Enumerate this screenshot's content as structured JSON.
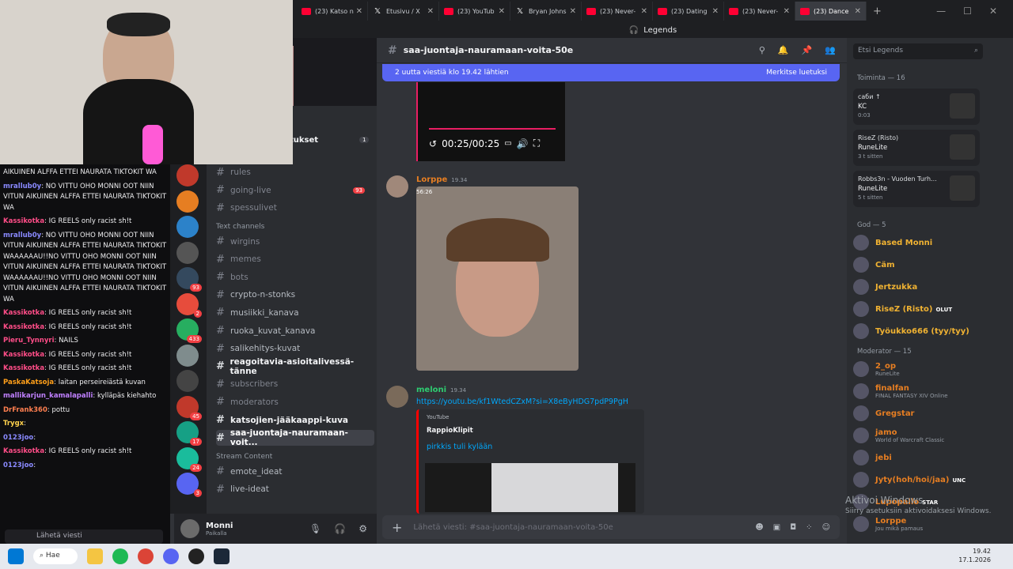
{
  "browser": {
    "tabs": [
      {
        "label": "(23) Katso n",
        "icon": "youtube"
      },
      {
        "label": "Etusivu / X",
        "icon": "x"
      },
      {
        "label": "(23) YouTub",
        "icon": "youtube"
      },
      {
        "label": "Bryan Johns",
        "icon": "x"
      },
      {
        "label": "(23) Never-",
        "icon": "youtube"
      },
      {
        "label": "(23) Dating",
        "icon": "youtube"
      },
      {
        "label": "(23) Never-",
        "icon": "youtube"
      },
      {
        "label": "(23) Dance",
        "icon": "youtube",
        "active": true
      }
    ],
    "new_tab": "+"
  },
  "discord": {
    "window_title": "Legends",
    "channel_name": "saa-juontaja-nauramaan-voita-50e",
    "banner": {
      "text": "2 uutta viestiä klo 19.42 lähtien",
      "action": "Merkitse luetuksi"
    },
    "sidebar_header": "tukset",
    "sidebar_header_badge": "1",
    "channels": [
      {
        "name": "rules",
        "state": "muted"
      },
      {
        "name": "going-live",
        "state": "muted",
        "badge": "93"
      },
      {
        "name": "spessulivet",
        "state": "muted"
      }
    ],
    "category_text": "Text channels",
    "text_channels": [
      {
        "name": "wirgins",
        "state": "muted"
      },
      {
        "name": "memes",
        "state": "muted"
      },
      {
        "name": "bots",
        "state": "muted"
      },
      {
        "name": "crypto-n-stonks",
        "state": "normal"
      },
      {
        "name": "musiikki_kanava",
        "state": "normal"
      },
      {
        "name": "ruoka_kuvat_kanava",
        "state": "normal"
      },
      {
        "name": "salikehitys-kuvat",
        "state": "normal"
      },
      {
        "name": "reagoitavia-asioitalivessä-tänne",
        "state": "unread"
      },
      {
        "name": "subscribers",
        "state": "muted"
      },
      {
        "name": "moderators",
        "state": "muted"
      },
      {
        "name": "katsojien-jääkaappi-kuva",
        "state": "unread"
      },
      {
        "name": "saa-juontaja-nauramaan-voit...",
        "state": "selected"
      }
    ],
    "category_stream": "Stream Content",
    "stream_channels": [
      {
        "name": "emote_ideat",
        "state": "normal"
      },
      {
        "name": "live-ideat",
        "state": "normal"
      }
    ],
    "user": {
      "name": "Monni",
      "status": "Paikalla"
    },
    "messages": [
      {
        "author": "Lorppe",
        "time": "19.34",
        "media_label": "56:26"
      },
      {
        "author": "meloni",
        "time": "19.34",
        "link": "https://youtu.be/kf1WtedCZxM?si=X8eByHDG7pdP9PgH",
        "embed": {
          "provider": "YouTube",
          "author": "RappioKlipit",
          "title": "pirkkis tuli kylään"
        }
      }
    ],
    "video_player": {
      "time": "00:25/00:25"
    },
    "compose_placeholder": "Lähetä viesti: #saa-juontaja-nauramaan-voita-50e",
    "search_placeholder": "Etsi Legends",
    "members": {
      "activity_header": "Toiminta — 16",
      "activities": [
        {
          "name": "саби ↑",
          "game": "KC",
          "time": "0:03"
        },
        {
          "name": "RiseZ (Risto)",
          "game": "RuneLite",
          "time": "3 t sitten"
        },
        {
          "name": "Robbs3n - Vuoden Turh...",
          "game": "RuneLite",
          "time": "5 t sitten"
        }
      ],
      "group1": "God — 5",
      "god": [
        {
          "name": "Based Monni",
          "color": "#f0b232"
        },
        {
          "name": "Cäm",
          "color": "#f0b232"
        },
        {
          "name": "Jertzukka",
          "color": "#f0b232"
        },
        {
          "name": "RiseZ (Risto)",
          "color": "#f0b232",
          "tag": "OLUT"
        },
        {
          "name": "Työukko666 (tyy/tyy)",
          "color": "#f0b232"
        }
      ],
      "group2": "Moderator — 15",
      "mods": [
        {
          "name": "2_op",
          "status": "RuneLite",
          "color": "#e67e22"
        },
        {
          "name": "finalfan",
          "status": "FINAL FANTASY XIV Online",
          "color": "#e67e22"
        },
        {
          "name": "Gregstar",
          "color": "#e67e22"
        },
        {
          "name": "jamo",
          "status": "World of Warcraft Classic",
          "color": "#e67e22"
        },
        {
          "name": "jebi",
          "color": "#e67e22"
        },
        {
          "name": "Jyty(hoh/hoi/jaa)",
          "tag": "UNC",
          "color": "#e67e22"
        },
        {
          "name": "Lupopallo",
          "tag": "STAR",
          "color": "#e67e22"
        },
        {
          "name": "Lorppe",
          "status": "Jou mikä pamaus",
          "color": "#e67e22"
        }
      ]
    }
  },
  "watermark": {
    "line1": "Aktivoi Windows",
    "line2": "Siirry asetuksiin aktivoidaksesi Windows."
  },
  "stream_chat": [
    {
      "user": "",
      "text": "AIKUINEN ALFFA ETTEI NAURATA TIKTOKIT WA",
      "color": "#efeff1"
    },
    {
      "user": "mrallub0y",
      "text": "NO VITTU OHO MONNI OOT NIIN VITUN AIKUINEN ALFFA ETTEI NAURATA TIKTOKIT WA",
      "color": "#8a8aff"
    },
    {
      "user": "Kassikotka",
      "text": "IG REELS only racist sh!t",
      "color": "#ff4d88"
    },
    {
      "user": "mrallub0y",
      "text": "NO VITTU OHO MONNI OOT NIIN VITUN AIKUINEN ALFFA ETTEI NAURATA TIKTOKIT WAAAAAAU!!NO VITTU OHO MONNI OOT NIIN VITUN AIKUINEN ALFFA ETTEI NAURATA TIKTOKIT WAAAAAAU!!NO VITTU OHO MONNI OOT NIIN VITUN AIKUINEN ALFFA ETTEI NAURATA TIKTOKIT WA",
      "color": "#8a8aff"
    },
    {
      "user": "Kassikotka",
      "text": "IG REELS only racist sh!t",
      "color": "#ff4d88"
    },
    {
      "user": "Kassikotka",
      "text": "IG REELS only racist sh!t",
      "color": "#ff4d88"
    },
    {
      "user": "Pieru_Tynnyri",
      "text": "NAILS",
      "color": "#ff4d88"
    },
    {
      "user": "Kassikotka",
      "text": "IG REELS only racist sh!t",
      "color": "#ff4d88"
    },
    {
      "user": "Kassikotka",
      "text": "IG REELS only racist sh!t",
      "color": "#ff4d88"
    },
    {
      "user": "PaskaKatsoja",
      "text": "laitan perseireiästä kuvan",
      "color": "#ff9f1a"
    },
    {
      "user": "mallikarjun_kamalapalli",
      "text": "kylläpäs kiehahto",
      "color": "#c080ff"
    },
    {
      "user": "DrFrank360",
      "text": "pottu",
      "color": "#ff7f50"
    },
    {
      "user": "Trygx",
      "text": "",
      "color": "#ffd24d"
    },
    {
      "user": "0123joo",
      "text": "",
      "color": "#8a8aff"
    },
    {
      "user": "Kassikotka",
      "text": "IG REELS only racist sh!t",
      "color": "#ff4d88"
    },
    {
      "user": "0123joo",
      "text": "",
      "color": "#8a8aff"
    }
  ],
  "stream_chat_input": "Lähetä viesti",
  "taskbar": {
    "search": "Hae",
    "time": "19.42",
    "date": "17.1.2026"
  }
}
